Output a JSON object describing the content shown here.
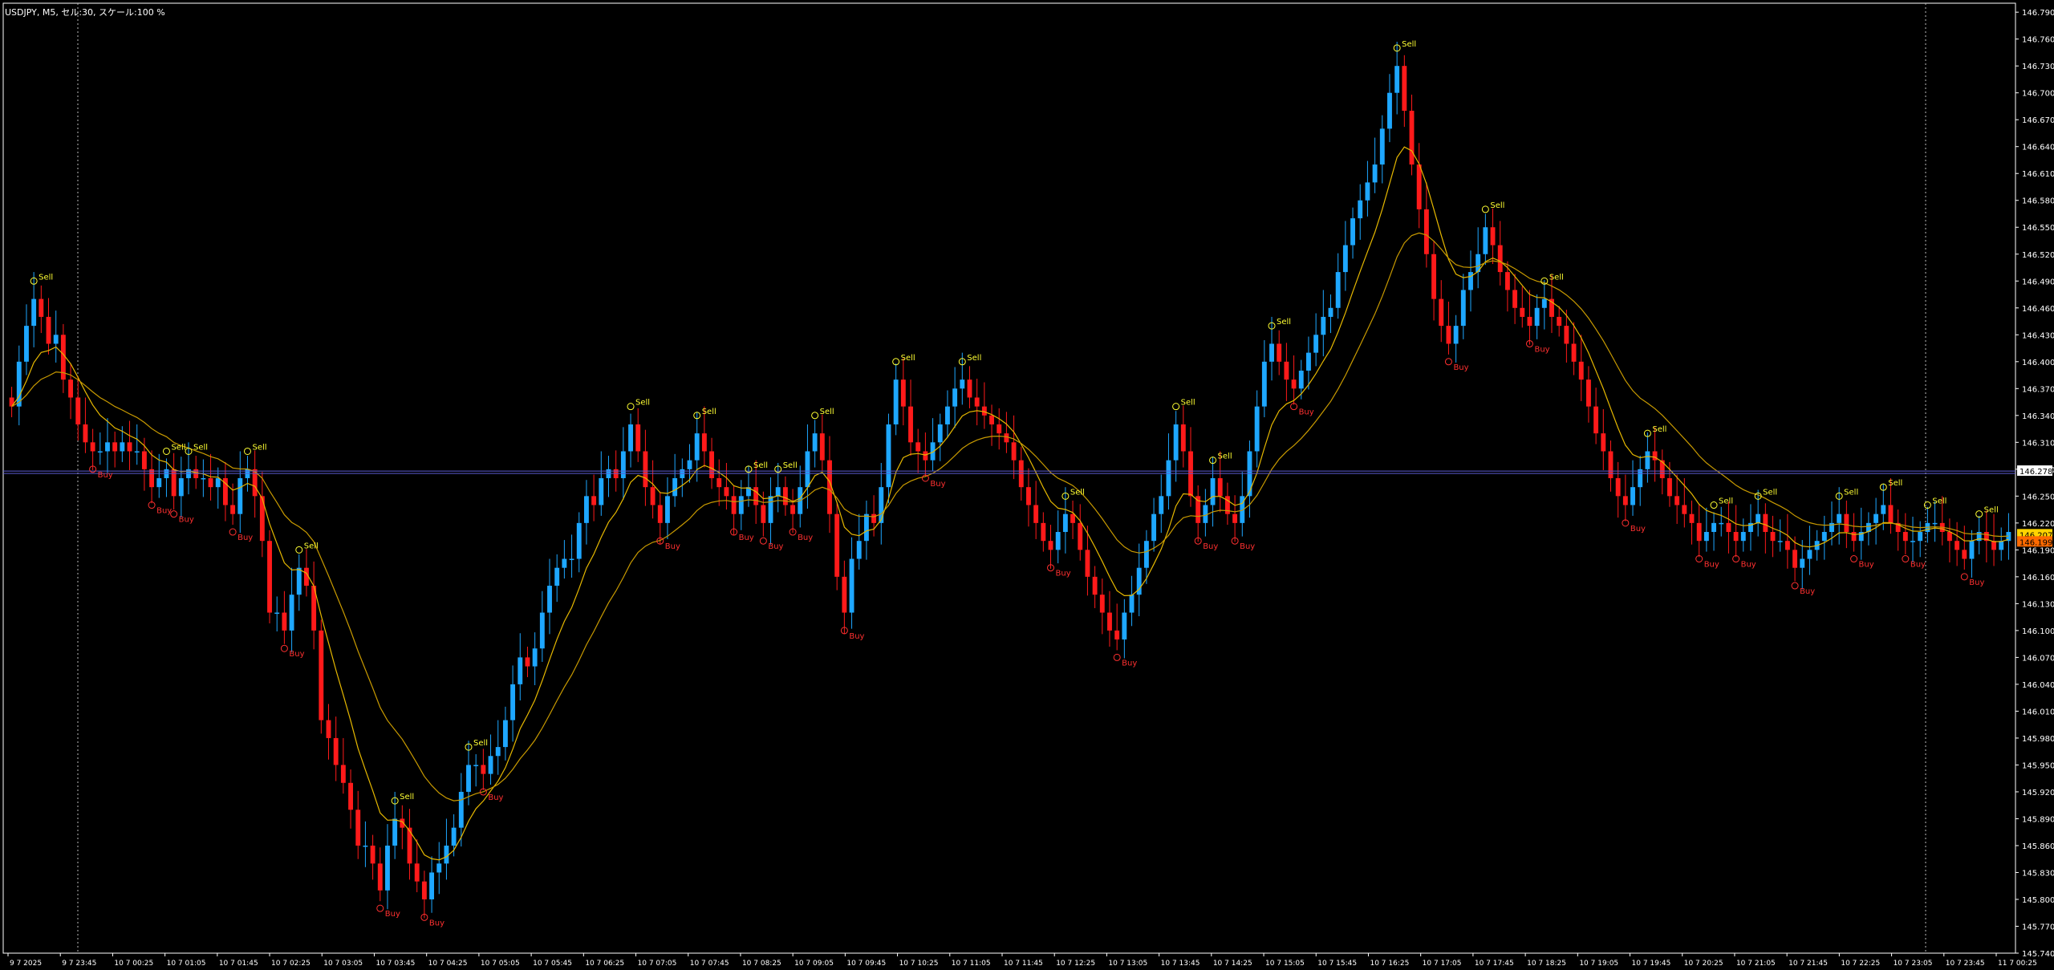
{
  "window": {
    "title": "USDJPY, M5, セル:30, スケール:100 %"
  },
  "price_scale": {
    "labels": [
      "146.790",
      "146.760",
      "146.730",
      "146.700",
      "146.670",
      "146.640",
      "146.610",
      "146.580",
      "146.550",
      "146.520",
      "146.490",
      "146.460",
      "146.430",
      "146.400",
      "146.370",
      "146.340",
      "146.310",
      "146.280",
      "146.250",
      "146.220",
      "146.190",
      "146.160",
      "146.130",
      "146.100",
      "146.070",
      "146.040",
      "146.010",
      "145.980",
      "145.950",
      "145.920",
      "145.890",
      "145.860",
      "145.830",
      "145.800",
      "145.770",
      "145.740"
    ],
    "current_bid": "146.278",
    "current_price_a": "146.207",
    "current_price_b": "146.199"
  },
  "time_scale": {
    "labels": [
      "9 7 2025",
      "9 7 23:45",
      "10 7 00:25",
      "10 7 01:05",
      "10 7 01:45",
      "10 7 02:25",
      "10 7 03:05",
      "10 7 03:45",
      "10 7 04:25",
      "10 7 05:05",
      "10 7 05:45",
      "10 7 06:25",
      "10 7 07:05",
      "10 7 07:45",
      "10 7 08:25",
      "10 7 09:05",
      "10 7 09:45",
      "10 7 10:25",
      "10 7 11:05",
      "10 7 11:45",
      "10 7 12:25",
      "10 7 13:05",
      "10 7 13:45",
      "10 7 14:25",
      "10 7 15:05",
      "10 7 15:45",
      "10 7 16:25",
      "10 7 17:05",
      "10 7 17:45",
      "10 7 18:25",
      "10 7 19:05",
      "10 7 19:45",
      "10 7 20:25",
      "10 7 21:05",
      "10 7 21:45",
      "10 7 22:25",
      "10 7 23:05",
      "10 7 23:45",
      "11 7 00:25"
    ]
  },
  "signals": {
    "sell_label": "Sell",
    "buy_label": "Buy"
  },
  "colors": {
    "background": "#000000",
    "bull_candle": "#1ea7ff",
    "bear_candle": "#ff1a1a",
    "ma_fast": "#e6b800",
    "ma_slow": "#c89a00",
    "bid_line": "#5a5ad0",
    "sell_text": "#ffff33",
    "buy_text": "#ff3030",
    "axis": "#ffffff",
    "price_tag_a_bg": "#ffd400",
    "price_tag_b_bg": "#ff6a00"
  },
  "chart_data": {
    "type": "candlestick",
    "symbol": "USDJPY",
    "timeframe": "M5",
    "ylim": [
      145.74,
      146.8
    ],
    "closes": [
      146.35,
      146.4,
      146.44,
      146.47,
      146.45,
      146.42,
      146.43,
      146.38,
      146.36,
      146.33,
      146.31,
      146.3,
      146.3,
      146.31,
      146.3,
      146.31,
      146.3,
      146.3,
      146.28,
      146.26,
      146.27,
      146.28,
      146.25,
      146.27,
      146.28,
      146.27,
      146.27,
      146.26,
      146.27,
      146.24,
      146.23,
      146.27,
      146.28,
      146.25,
      146.2,
      146.12,
      146.12,
      146.1,
      146.14,
      146.17,
      146.15,
      146.1,
      146.0,
      145.98,
      145.95,
      145.93,
      145.9,
      145.86,
      145.86,
      145.84,
      145.81,
      145.86,
      145.89,
      145.88,
      145.84,
      145.82,
      145.8,
      145.83,
      145.84,
      145.86,
      145.88,
      145.92,
      145.95,
      145.95,
      145.94,
      145.96,
      145.97,
      146.0,
      146.04,
      146.07,
      146.06,
      146.08,
      146.12,
      146.15,
      146.17,
      146.18,
      146.18,
      146.22,
      146.25,
      146.24,
      146.27,
      146.28,
      146.27,
      146.3,
      146.33,
      146.3,
      146.26,
      146.24,
      146.22,
      146.25,
      146.27,
      146.28,
      146.29,
      146.32,
      146.3,
      146.27,
      146.26,
      146.25,
      146.23,
      146.25,
      146.26,
      146.24,
      146.22,
      146.25,
      146.26,
      146.24,
      146.23,
      146.26,
      146.3,
      146.32,
      146.29,
      146.23,
      146.16,
      146.12,
      146.18,
      146.2,
      146.23,
      146.22,
      146.26,
      146.33,
      146.38,
      146.35,
      146.31,
      146.3,
      146.29,
      146.31,
      146.33,
      146.35,
      146.37,
      146.38,
      146.36,
      146.35,
      146.34,
      146.33,
      146.32,
      146.31,
      146.29,
      146.26,
      146.24,
      146.22,
      146.2,
      146.19,
      146.21,
      146.23,
      146.22,
      146.19,
      146.16,
      146.14,
      146.12,
      146.1,
      146.09,
      146.12,
      146.14,
      146.17,
      146.2,
      146.23,
      146.25,
      146.29,
      146.33,
      146.3,
      146.25,
      146.22,
      146.24,
      146.27,
      146.25,
      146.23,
      146.22,
      146.25,
      146.3,
      146.35,
      146.4,
      146.42,
      146.4,
      146.38,
      146.37,
      146.39,
      146.41,
      146.43,
      146.45,
      146.46,
      146.5,
      146.53,
      146.56,
      146.58,
      146.6,
      146.62,
      146.66,
      146.7,
      146.73,
      146.68,
      146.62,
      146.57,
      146.52,
      146.47,
      146.44,
      146.42,
      146.44,
      146.48,
      146.5,
      146.52,
      146.55,
      146.53,
      146.5,
      146.48,
      146.46,
      146.45,
      146.44,
      146.46,
      146.47,
      146.45,
      146.44,
      146.42,
      146.4,
      146.38,
      146.35,
      146.32,
      146.3,
      146.27,
      146.25,
      146.24,
      146.26,
      146.28,
      146.3,
      146.29,
      146.27,
      146.25,
      146.24,
      146.23,
      146.22,
      146.2,
      146.21,
      146.22,
      146.22,
      146.21,
      146.2,
      146.21,
      146.22,
      146.23,
      146.21,
      146.2,
      146.2,
      146.19,
      146.17,
      146.18,
      146.19,
      146.2,
      146.21,
      146.22,
      146.23,
      146.21,
      146.2,
      146.21,
      146.22,
      146.23,
      146.24,
      146.22,
      146.21,
      146.2,
      146.2,
      146.21,
      146.22,
      146.22,
      146.21,
      146.2,
      146.19,
      146.18,
      146.2,
      146.21,
      146.2,
      146.19,
      146.2,
      146.21
    ]
  }
}
